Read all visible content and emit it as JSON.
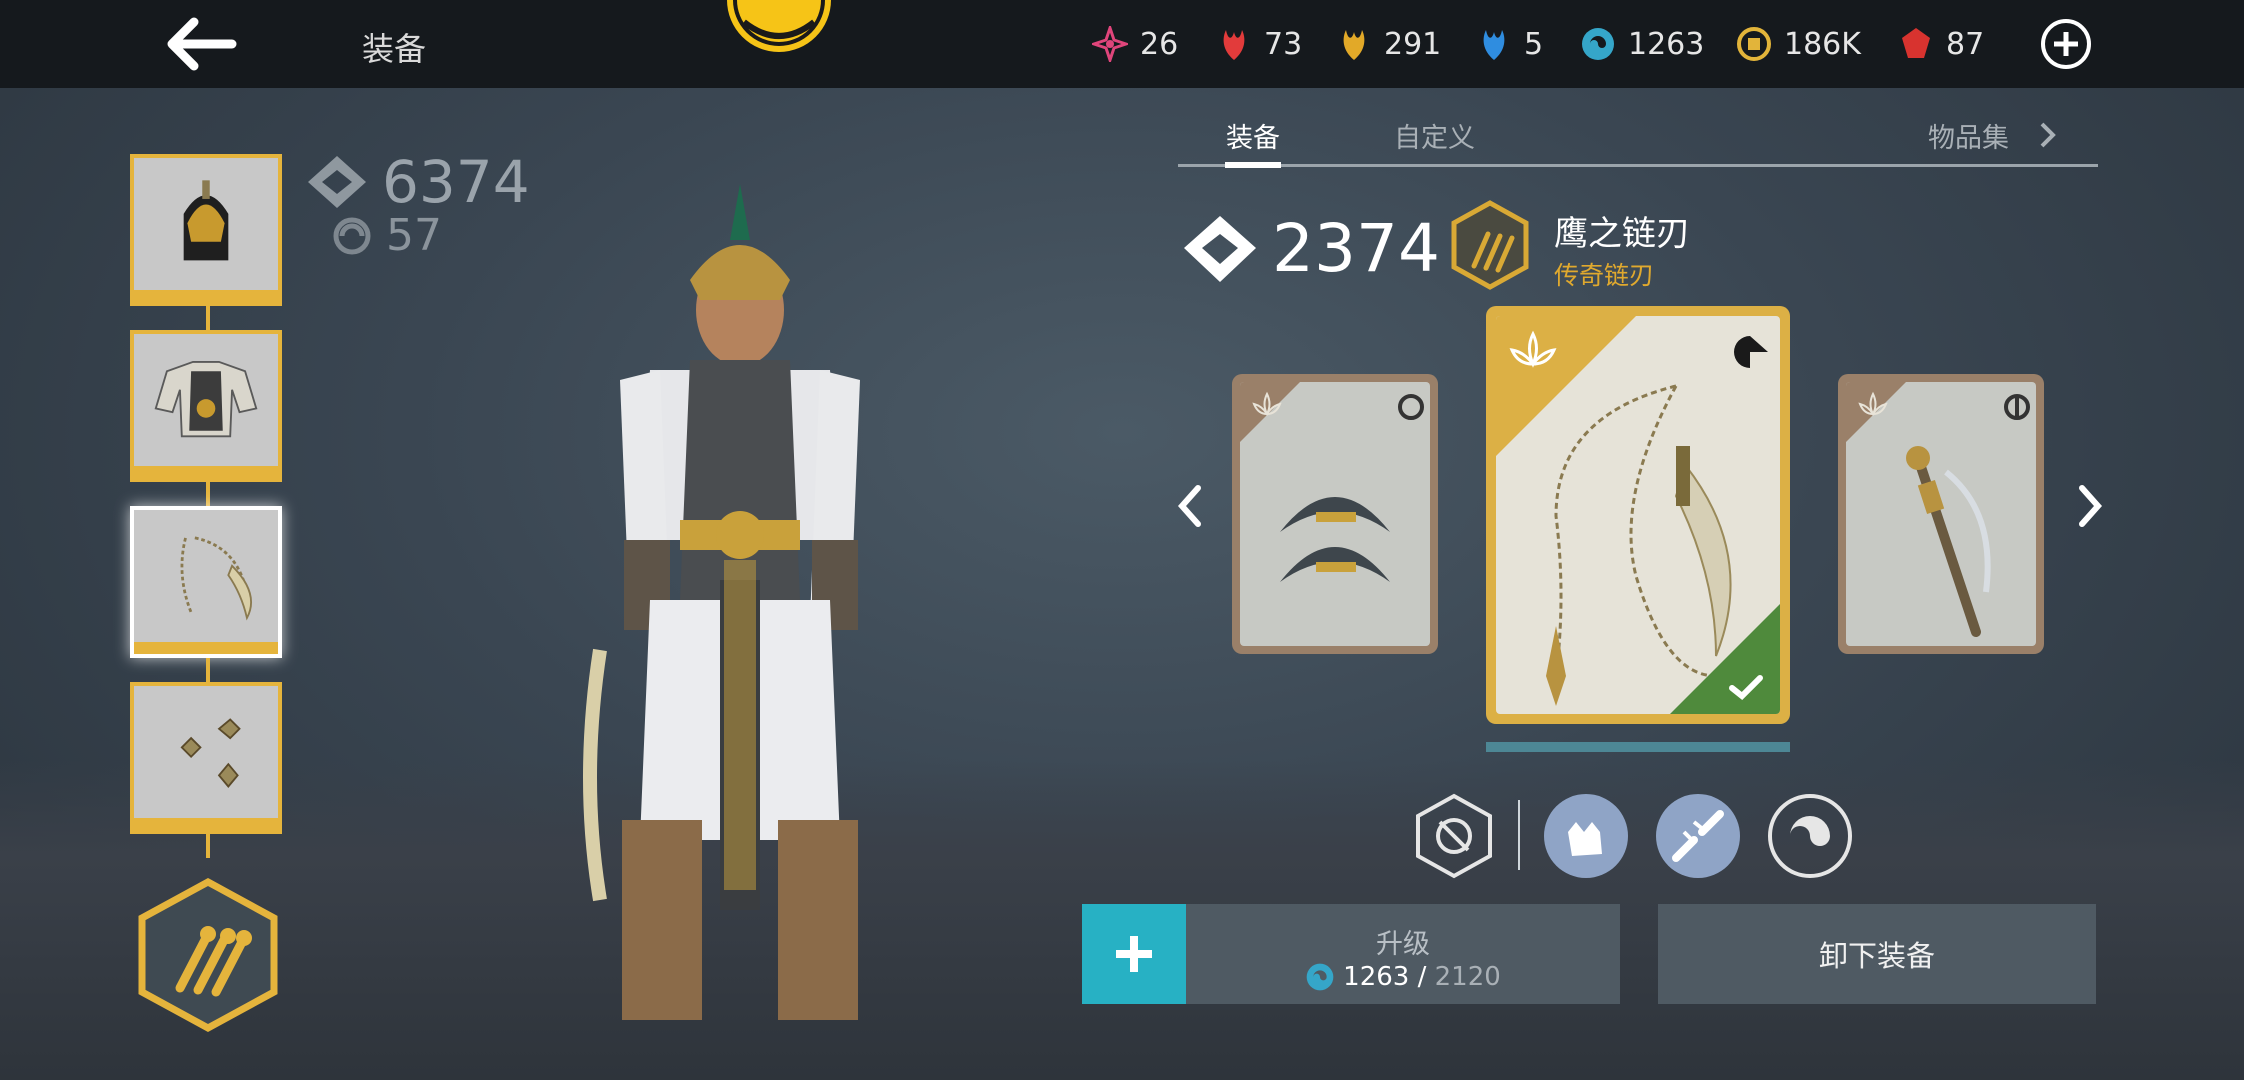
{
  "header": {
    "title": "装备",
    "currencies": [
      {
        "icon": "pink-crystal-icon",
        "value": "26",
        "color": "#e0457b"
      },
      {
        "icon": "red-leaf-icon",
        "value": "73",
        "color": "#e23b3b"
      },
      {
        "icon": "gold-leaf-icon",
        "value": "291",
        "color": "#e2a928"
      },
      {
        "icon": "blue-leaf-icon",
        "value": "5",
        "color": "#2f8de0"
      },
      {
        "icon": "swirl-orb-icon",
        "value": "1263",
        "color": "#35a6c9"
      },
      {
        "icon": "gold-coin-icon",
        "value": "186K",
        "color": "#e2b43a"
      },
      {
        "icon": "ruby-gem-icon",
        "value": "87",
        "color": "#d8332f"
      }
    ]
  },
  "left_panel": {
    "total_power": "6374",
    "level": "57",
    "slots": [
      {
        "name": "helmet-slot",
        "icon": "helmet-icon"
      },
      {
        "name": "armor-slot",
        "icon": "armor-icon"
      },
      {
        "name": "weapon-slot",
        "icon": "chain-blade-icon",
        "selected": true
      },
      {
        "name": "ranged-slot",
        "icon": "shuriken-icon"
      }
    ],
    "badge_icon": "weapon-class-badge-icon"
  },
  "tabs": [
    {
      "label": "装备",
      "active": true
    },
    {
      "label": "自定义",
      "active": false
    },
    {
      "label": "物品集",
      "active": false
    }
  ],
  "weapon": {
    "power": "2374",
    "name": "鹰之链刃",
    "type": "传奇链刃",
    "type_color": "#e0a92e"
  },
  "cards": [
    {
      "position": "left",
      "icon": "crescent-blades-icon",
      "equipped": false
    },
    {
      "position": "center",
      "icon": "chain-sickle-icon",
      "equipped": true
    },
    {
      "position": "right",
      "icon": "staff-icon",
      "equipped": false
    }
  ],
  "skills": [
    {
      "icon": "no-weapon-skill-icon"
    },
    {
      "icon": "fist-skill-icon"
    },
    {
      "icon": "broken-chain-skill-icon"
    },
    {
      "icon": "swirl-skill-icon"
    }
  ],
  "actions": {
    "upgrade_label": "升级",
    "upgrade_current": "1263",
    "upgrade_separator": " / ",
    "upgrade_required": "2120",
    "unequip_label": "卸下装备"
  },
  "colors": {
    "accent_gold": "#e5b43c",
    "accent_teal": "#27b1c4",
    "equipped_green": "#4f8a3c"
  }
}
